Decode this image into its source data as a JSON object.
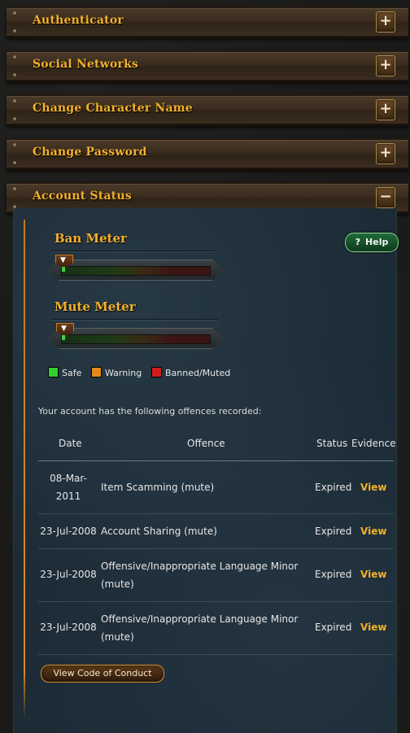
{
  "sections": [
    {
      "title": "Authenticator",
      "toggle": "+"
    },
    {
      "title": "Social Networks",
      "toggle": "+"
    },
    {
      "title": "Change Character Name",
      "toggle": "+"
    },
    {
      "title": "Change Password",
      "toggle": "+"
    },
    {
      "title": "Account Status",
      "toggle": "−"
    }
  ],
  "account_status": {
    "help_icon": "?",
    "help_label": "Help",
    "ban_meter": {
      "title": "Ban Meter",
      "level_pct": 6
    },
    "mute_meter": {
      "title": "Mute Meter",
      "level_pct": 6
    },
    "legend": [
      {
        "label": "Safe",
        "color": "#2fd12f"
      },
      {
        "label": "Warning",
        "color": "#e38a1a"
      },
      {
        "label": "Banned/Muted",
        "color": "#d11d1d"
      }
    ],
    "note": "Your account has the following offences recorded:",
    "columns": {
      "date": "Date",
      "offence": "Offence",
      "status": "Status",
      "evidence": "Evidence"
    },
    "offences": [
      {
        "date": "08-Mar-2011",
        "offence": "Item Scamming (mute)",
        "status": "Expired",
        "evidence": "View"
      },
      {
        "date": "23-Jul-2008",
        "offence": "Account Sharing (mute)",
        "status": "Expired",
        "evidence": "View"
      },
      {
        "date": "23-Jul-2008",
        "offence": "Offensive/Inappropriate Language Minor (mute)",
        "status": "Expired",
        "evidence": "View"
      },
      {
        "date": "23-Jul-2008",
        "offence": "Offensive/Inappropriate Language Minor (mute)",
        "status": "Expired",
        "evidence": "View"
      }
    ],
    "code_of_conduct_label": "View Code of Conduct"
  },
  "icons": {
    "expand": "plus-icon",
    "collapse": "minus-icon",
    "marker": "triangle-down-icon"
  }
}
